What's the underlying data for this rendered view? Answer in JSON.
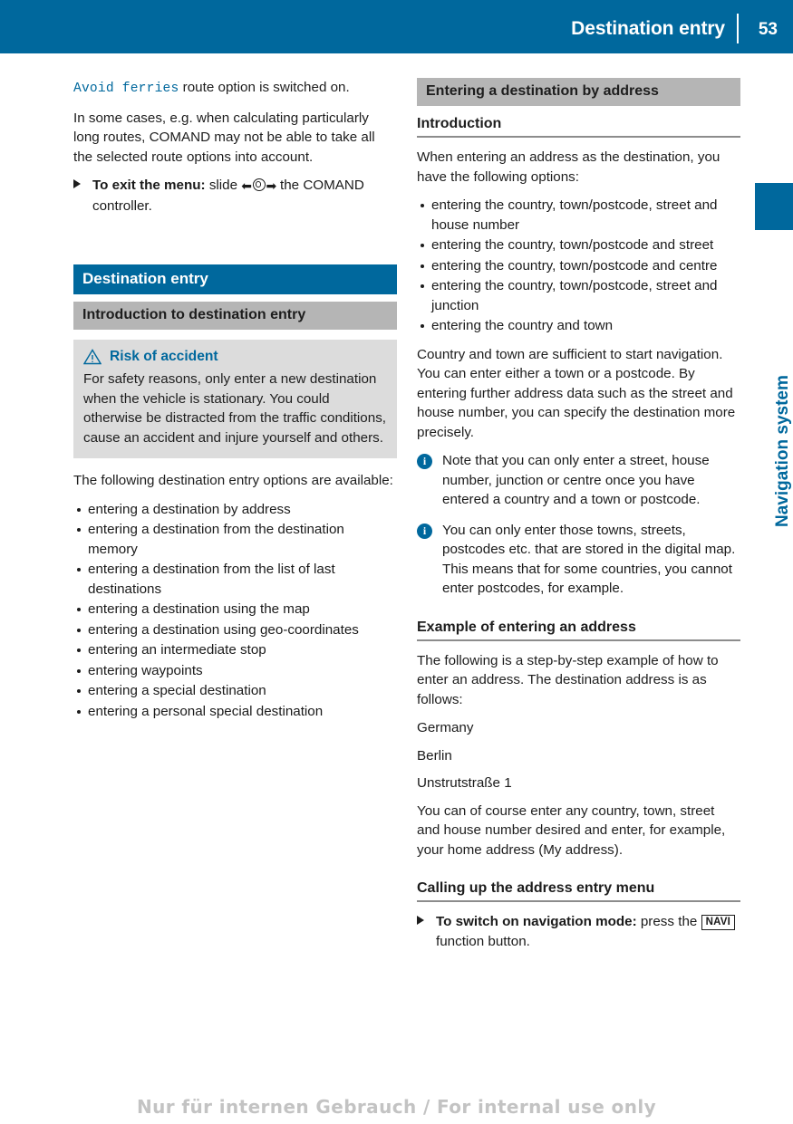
{
  "header": {
    "title": "Destination entry",
    "page_number": "53",
    "bg_color": "#00689d"
  },
  "side_tab": {
    "label": "Navigation system",
    "color": "#00689d"
  },
  "left_column": {
    "intro_paragraph": {
      "code_text": "Avoid ferries",
      "rest_text": " route option is switched on."
    },
    "paragraph_2": "In some cases, e.g. when calculating particularly long routes, COMAND may not be able to take all the selected route options into account.",
    "exit_step": {
      "bold_lead": "To exit the menu:",
      "middle": " slide ",
      "tail": " the COMAND controller."
    },
    "chapter_banner": "Destination entry",
    "section_banner": "Introduction to destination entry",
    "warning": {
      "title": "Risk of accident",
      "body": "For safety reasons, only enter a new destination when the vehicle is stationary. You could otherwise be distracted from the traffic conditions, cause an accident and injure yourself and others.",
      "title_color": "#00689d",
      "box_color": "#dcdcdc"
    },
    "options_lead": "The following destination entry options are available:",
    "options": [
      "entering a destination by address",
      "entering a destination from the destination memory",
      "entering a destination from the list of last destinations",
      "entering a destination using the map",
      "entering a destination using geo-coordinates",
      "entering an intermediate stop",
      "entering waypoints",
      "entering a special destination",
      "entering a personal special destination"
    ]
  },
  "right_column": {
    "section_banner": "Entering a destination by address",
    "introduction_heading": "Introduction",
    "intro_lead": "When entering an address as the destination, you have the following options:",
    "address_options": [
      "entering the country, town/postcode, street and house number",
      "entering the country, town/postcode and street",
      "entering the country, town/postcode and centre",
      "entering the country, town/postcode, street and junction",
      "entering the country and town"
    ],
    "country_town_paragraph": "Country and town are sufficient to start navigation. You can enter either a town or a postcode. By entering further address data such as the street and house number, you can specify the destination more precisely.",
    "notes": [
      "Note that you can only enter a street, house number, junction or centre once you have entered a country and a town or postcode.",
      "You can only enter those towns, streets, postcodes etc. that are stored in the digital map. This means that for some countries, you cannot enter postcodes, for example."
    ],
    "example_heading": "Example of entering an address",
    "example_lead": "The following is a step-by-step example of how to enter an address. The destination address is as follows:",
    "example_address": [
      "Germany",
      "Berlin",
      "Unstrutstraße 1"
    ],
    "example_tail": "You can of course enter any country, town, street and house number desired and enter, for example, your home address (My address).",
    "calling_heading": "Calling up the address entry menu",
    "navi_step": {
      "bold_lead": "To switch on navigation mode:",
      "middle": " press the ",
      "key_label": "NAVI",
      "tail": " function button."
    }
  },
  "footer": {
    "watermark": "Nur für internen Gebrauch / For internal use only"
  }
}
